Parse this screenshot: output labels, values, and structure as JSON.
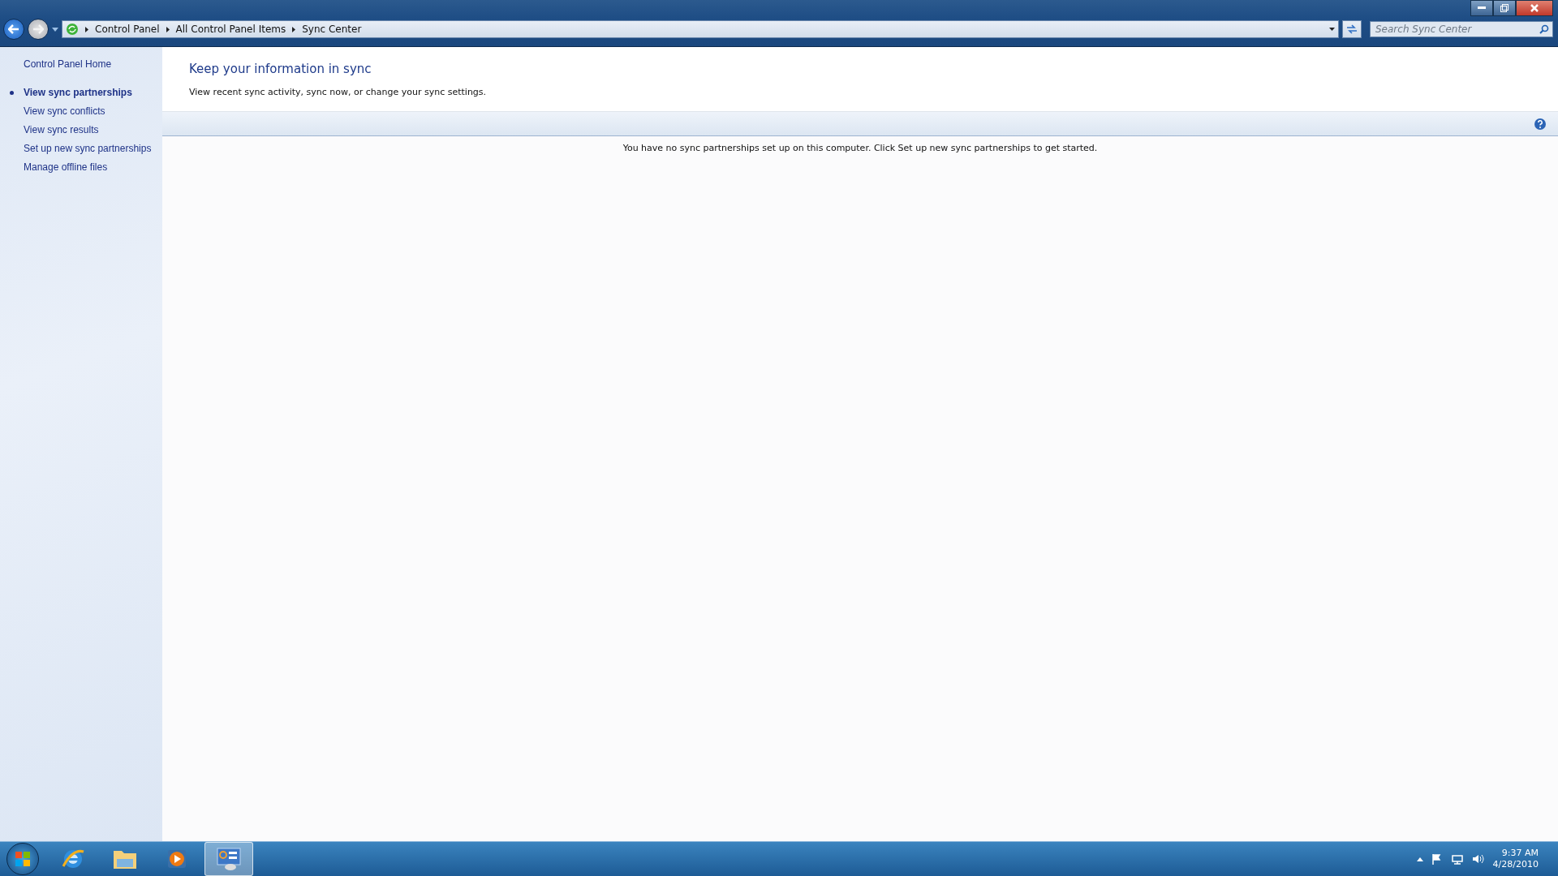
{
  "address_bar": {
    "crumbs": [
      "Control Panel",
      "All Control Panel Items",
      "Sync Center"
    ]
  },
  "search": {
    "placeholder": "Search Sync Center"
  },
  "sidebar": {
    "home": "Control Panel Home",
    "items": [
      {
        "label": "View sync partnerships",
        "selected": true
      },
      {
        "label": "View sync conflicts",
        "selected": false
      },
      {
        "label": "View sync results",
        "selected": false
      },
      {
        "label": "Set up new sync partnerships",
        "selected": false
      },
      {
        "label": "Manage offline files",
        "selected": false
      }
    ]
  },
  "content": {
    "title": "Keep your information in sync",
    "description": "View recent sync activity, sync now, or change your sync settings.",
    "message": "You have no sync partnerships set up on this computer. Click Set up new sync partnerships to get started."
  },
  "taskbar": {
    "apps": [
      {
        "kind": "browser",
        "selected": false
      },
      {
        "kind": "folder",
        "selected": false
      },
      {
        "kind": "player",
        "selected": false
      },
      {
        "kind": "panel",
        "selected": true
      }
    ],
    "time": "9:37 AM",
    "date": "4/28/2010"
  }
}
